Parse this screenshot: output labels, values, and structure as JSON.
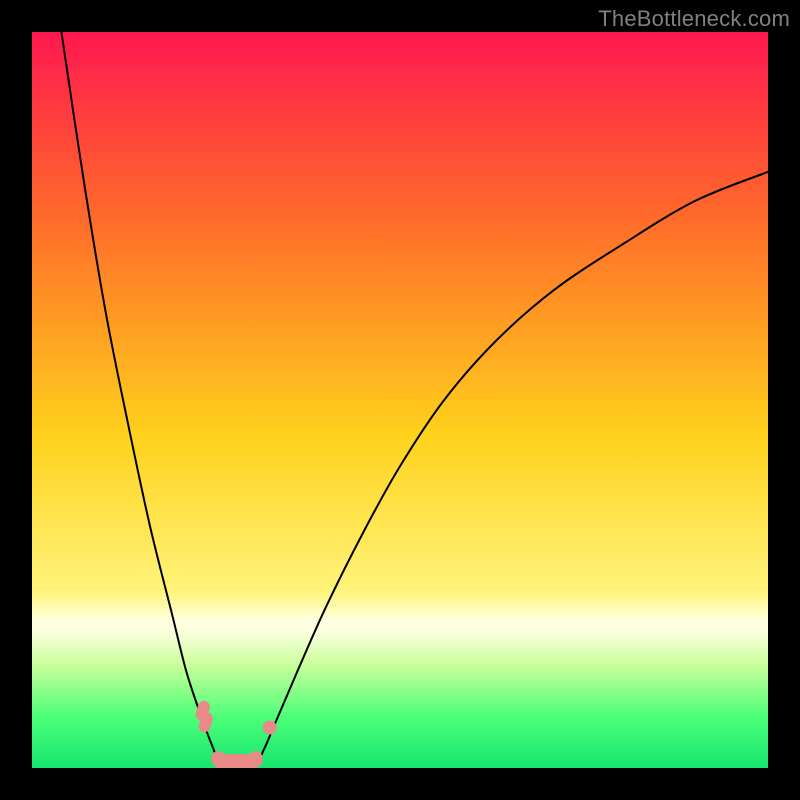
{
  "watermark": "TheBottleneck.com",
  "chart_data": {
    "type": "line",
    "title": "",
    "xlabel": "",
    "ylabel": "",
    "xlim": [
      0,
      100
    ],
    "ylim": [
      0,
      100
    ],
    "gradient_stops": [
      {
        "offset": 0,
        "color": "#ff1850"
      },
      {
        "offset": 25,
        "color": "#ff6a2a"
      },
      {
        "offset": 55,
        "color": "#ffd21c"
      },
      {
        "offset": 76,
        "color": "#fff47a"
      },
      {
        "offset": 80,
        "color": "#ffffe0"
      },
      {
        "offset": 82,
        "color": "#f7ffd8"
      },
      {
        "offset": 86,
        "color": "#c8ff9a"
      },
      {
        "offset": 93,
        "color": "#4dff78"
      },
      {
        "offset": 100,
        "color": "#15e66e"
      }
    ],
    "series": [
      {
        "name": "bottleneck-curve",
        "points": [
          {
            "x": 4,
            "y": 100
          },
          {
            "x": 7,
            "y": 80
          },
          {
            "x": 10,
            "y": 62
          },
          {
            "x": 13,
            "y": 47
          },
          {
            "x": 16,
            "y": 33
          },
          {
            "x": 19,
            "y": 21
          },
          {
            "x": 21,
            "y": 13
          },
          {
            "x": 23,
            "y": 7
          },
          {
            "x": 24.5,
            "y": 3
          },
          {
            "x": 26,
            "y": 0
          },
          {
            "x": 30,
            "y": 0
          },
          {
            "x": 31.5,
            "y": 2.5
          },
          {
            "x": 33,
            "y": 6
          },
          {
            "x": 36,
            "y": 13
          },
          {
            "x": 40,
            "y": 22
          },
          {
            "x": 45,
            "y": 32
          },
          {
            "x": 50,
            "y": 41
          },
          {
            "x": 56,
            "y": 50
          },
          {
            "x": 63,
            "y": 58
          },
          {
            "x": 71,
            "y": 65
          },
          {
            "x": 80,
            "y": 71
          },
          {
            "x": 90,
            "y": 77
          },
          {
            "x": 100,
            "y": 81
          }
        ]
      },
      {
        "name": "left-marker-cluster",
        "points": [
          {
            "x": 23.2,
            "y": 7.8
          },
          {
            "x": 23.6,
            "y": 6.2
          }
        ]
      },
      {
        "name": "right-marker-cluster",
        "points": [
          {
            "x": 32.3,
            "y": 5.5
          }
        ]
      },
      {
        "name": "bottom-marker-bar",
        "y": 0,
        "x_range": [
          24.5,
          31.2
        ]
      }
    ]
  }
}
